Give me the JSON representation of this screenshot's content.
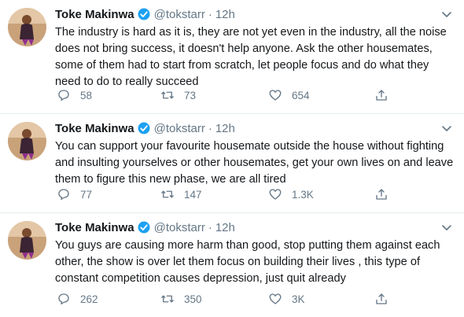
{
  "colors": {
    "text": "#14171a",
    "muted": "#657786",
    "verified": "#1da1f2",
    "divider": "#e6ecf0"
  },
  "icons": [
    "verified-badge-icon",
    "caret-down-icon",
    "reply-icon",
    "retweet-icon",
    "like-icon",
    "share-icon"
  ],
  "tweets": [
    {
      "author": "Toke Makinwa",
      "handle": "@tokstarr",
      "dot": "·",
      "time": "12h",
      "text": "The industry is hard as it is, they are not yet even in the industry, all the noise does not bring success, it doesn't help anyone. Ask the other housemates, some of them had to start from scratch, let people focus and do what they need to do to really succeed",
      "replies": "58",
      "retweets": "73",
      "likes": "654"
    },
    {
      "author": "Toke Makinwa",
      "handle": "@tokstarr",
      "dot": "·",
      "time": "12h",
      "text": "You can support your favourite housemate outside the house without fighting and insulting yourselves or other housemates, get your own lives on and leave them to figure this new phase, we are all tired",
      "replies": "77",
      "retweets": "147",
      "likes": "1.3K"
    },
    {
      "author": "Toke Makinwa",
      "handle": "@tokstarr",
      "dot": "·",
      "time": "12h",
      "text": "You guys are causing more harm than good, stop putting them against each other, the show is over let them focus on building their lives , this type of constant competition causes depression, just quit already",
      "replies": "262",
      "retweets": "350",
      "likes": "3K"
    }
  ]
}
